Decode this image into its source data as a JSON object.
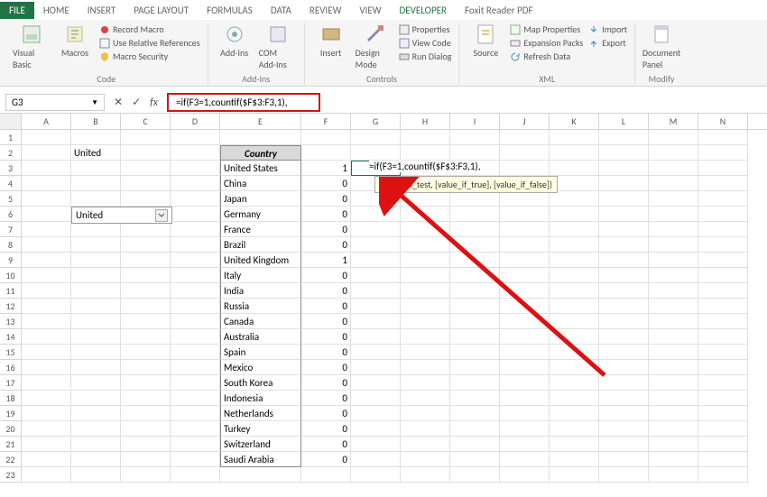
{
  "tabs": {
    "file": "FILE",
    "home": "HOME",
    "insert": "INSERT",
    "pagelayout": "PAGE LAYOUT",
    "formulas": "FORMULAS",
    "data": "DATA",
    "review": "REVIEW",
    "view": "VIEW",
    "developer": "DEVELOPER",
    "foxit": "Foxit Reader PDF"
  },
  "ribbon": {
    "code": {
      "label": "Code",
      "vb": "Visual Basic",
      "macros": "Macros",
      "record": "Record Macro",
      "relref": "Use Relative References",
      "security": "Macro Security"
    },
    "addins": {
      "label": "Add-Ins",
      "addins": "Add-Ins",
      "com": "COM Add-Ins"
    },
    "controls": {
      "label": "Controls",
      "insert": "Insert",
      "design": "Design Mode",
      "props": "Properties",
      "viewcode": "View Code",
      "rundialog": "Run Dialog"
    },
    "xml": {
      "label": "XML",
      "source": "Source",
      "mapprops": "Map Properties",
      "expansion": "Expansion Packs",
      "refresh": "Refresh Data",
      "import": "Import",
      "export": "Export"
    },
    "modify": {
      "label": "Modify",
      "docpanel": "Document Panel"
    }
  },
  "namebox": "G3",
  "formula": "=if(F3=1,countif($F$3:F3,1),",
  "editing_formula": "=if(F3=1,countif($F$3:F3,1),",
  "tooltip": "IF(logical_test, [value_if_true], [value_if_false])",
  "b2": "United",
  "dd_value": "United",
  "columns": [
    "A",
    "B",
    "C",
    "D",
    "E",
    "F",
    "G",
    "H",
    "I",
    "J",
    "K",
    "L",
    "M",
    "N"
  ],
  "table_header": "Country",
  "countries": [
    "United States",
    "China",
    "Japan",
    "Germany",
    "France",
    "Brazil",
    "United Kingdom",
    "Italy",
    "India",
    "Russia",
    "Canada",
    "Australia",
    "Spain",
    "Mexico",
    "South Korea",
    "Indonesia",
    "Netherlands",
    "Turkey",
    " Switzerland",
    "Saudi Arabia"
  ],
  "fvals": [
    "1",
    "0",
    "0",
    "0",
    "0",
    "0",
    "1",
    "0",
    "0",
    "0",
    "0",
    "0",
    "0",
    "0",
    "0",
    "0",
    "0",
    "0",
    "0",
    "0"
  ]
}
